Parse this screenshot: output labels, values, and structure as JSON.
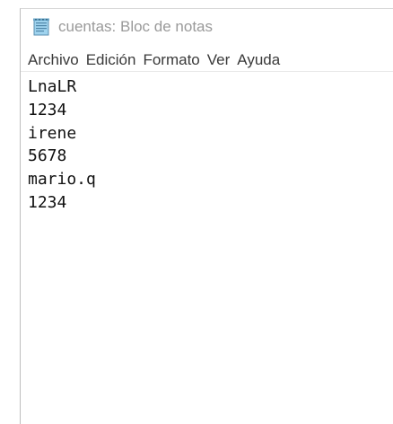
{
  "window": {
    "title": "cuentas: Bloc de notas",
    "app_icon": "notepad-icon"
  },
  "menubar": {
    "items": [
      {
        "label": "Archivo"
      },
      {
        "label": "Edición"
      },
      {
        "label": "Formato"
      },
      {
        "label": "Ver"
      },
      {
        "label": "Ayuda"
      }
    ]
  },
  "editor": {
    "lines": [
      "LnaLR",
      "1234",
      "irene",
      "5678",
      "mario.q",
      "1234"
    ]
  }
}
